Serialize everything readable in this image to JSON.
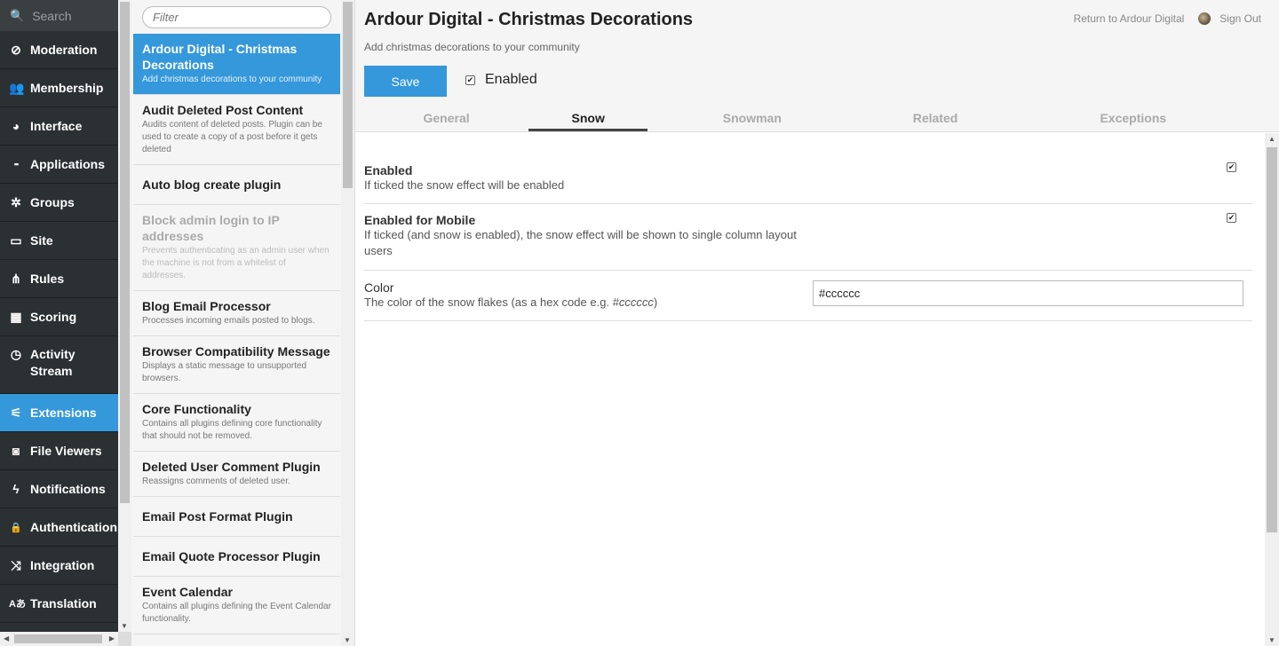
{
  "nav": {
    "search_label": "Search",
    "items": [
      {
        "label": "Moderation",
        "icon": "⊘"
      },
      {
        "label": "Membership",
        "icon": "👥"
      },
      {
        "label": "Interface",
        "icon": "◕"
      },
      {
        "label": "Applications",
        "icon": "▪"
      },
      {
        "label": "Groups",
        "icon": "✲"
      },
      {
        "label": "Site",
        "icon": "▭"
      },
      {
        "label": "Rules",
        "icon": "⋔"
      },
      {
        "label": "Scoring",
        "icon": "▦"
      },
      {
        "label": "Activity Stream",
        "icon": "◷"
      },
      {
        "label": "Extensions",
        "icon": "⚟"
      },
      {
        "label": "File Viewers",
        "icon": "◙"
      },
      {
        "label": "Notifications",
        "icon": "ϟ"
      },
      {
        "label": "Authentication",
        "icon": "🔒"
      },
      {
        "label": "Integration",
        "icon": "⤨"
      },
      {
        "label": "Translation",
        "icon": "A̶"
      }
    ],
    "active_color": "#3498db"
  },
  "plugins": {
    "filter_placeholder": "Filter",
    "items": [
      {
        "title": "Ardour Digital - Christmas Decorations",
        "desc": "Add christmas decorations to your community"
      },
      {
        "title": "Audit Deleted Post Content",
        "desc": "Audits content of deleted posts. Plugin can be used to create a copy of a post before it gets deleted"
      },
      {
        "title": "Auto blog create plugin",
        "desc": ""
      },
      {
        "title": "Block admin login to IP addresses",
        "desc": "Prevents authenticating as an admin user when the machine is not from a whitelist of addresses."
      },
      {
        "title": "Blog Email Processor",
        "desc": "Processes incoming emails posted to blogs."
      },
      {
        "title": "Browser Compatibility Message",
        "desc": "Displays a static message to unsupported browsers."
      },
      {
        "title": "Core Functionality",
        "desc": "Contains all plugins defining core functionality that should not be removed."
      },
      {
        "title": "Deleted User Comment Plugin",
        "desc": "Reassigns comments of deleted user."
      },
      {
        "title": "Email Post Format Plugin",
        "desc": ""
      },
      {
        "title": "Email Quote Processor Plugin",
        "desc": ""
      },
      {
        "title": "Event Calendar",
        "desc": "Contains all plugins defining the Event Calendar functionality."
      }
    ]
  },
  "header": {
    "title": "Ardour Digital - Christmas Decorations",
    "subtitle": "Add christmas decorations to your community",
    "return_link": "Return to Ardour Digital",
    "sign_out": "Sign Out",
    "save_label": "Save",
    "enabled_label": "Enabled",
    "enabled_checked": true
  },
  "tabs": [
    {
      "label": "General"
    },
    {
      "label": "Snow"
    },
    {
      "label": "Snowman"
    },
    {
      "label": "Related"
    },
    {
      "label": "Exceptions"
    }
  ],
  "active_tab": "Snow",
  "settings": {
    "enabled": {
      "label": "Enabled",
      "desc": "If ticked the snow effect will be enabled",
      "checked": true
    },
    "enabled_mobile": {
      "label": "Enabled for Mobile",
      "desc": "If ticked (and snow is enabled), the snow effect will be shown to single column layout users",
      "checked": true
    },
    "color": {
      "label": "Color",
      "desc_prefix": "The color of the snow flakes (as a hex code e.g. ",
      "desc_example": "#cccccc",
      "desc_suffix": ")",
      "value": "#cccccc"
    }
  }
}
